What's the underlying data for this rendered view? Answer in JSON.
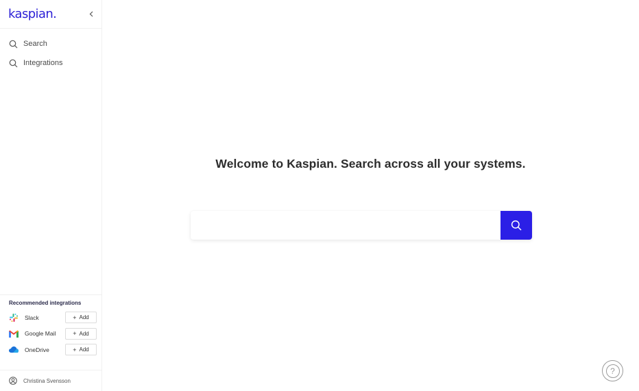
{
  "app": {
    "logo_text": "kaspian.",
    "brand_color": "#2b1fd6",
    "accent_color": "#2b1fe6"
  },
  "sidebar": {
    "collapse_icon": "chevron-left-icon",
    "nav": [
      {
        "label": "Search",
        "icon": "search-icon"
      },
      {
        "label": "Integrations",
        "icon": "search-icon"
      }
    ],
    "recommended": {
      "title": "Recommended integrations",
      "items": [
        {
          "name": "Slack",
          "icon": "slack-icon",
          "add_label": "Add"
        },
        {
          "name": "Google Mail",
          "icon": "gmail-icon",
          "add_label": "Add"
        },
        {
          "name": "OneDrive",
          "icon": "onedrive-icon",
          "add_label": "Add"
        }
      ]
    },
    "user": {
      "name": "Christina Svensson",
      "icon": "user-circle-icon"
    }
  },
  "main": {
    "welcome": "Welcome to Kaspian. Search across all your systems.",
    "search": {
      "value": "",
      "placeholder": "",
      "button_icon": "search-icon"
    },
    "help": {
      "icon": "help-icon",
      "glyph": "?"
    }
  }
}
